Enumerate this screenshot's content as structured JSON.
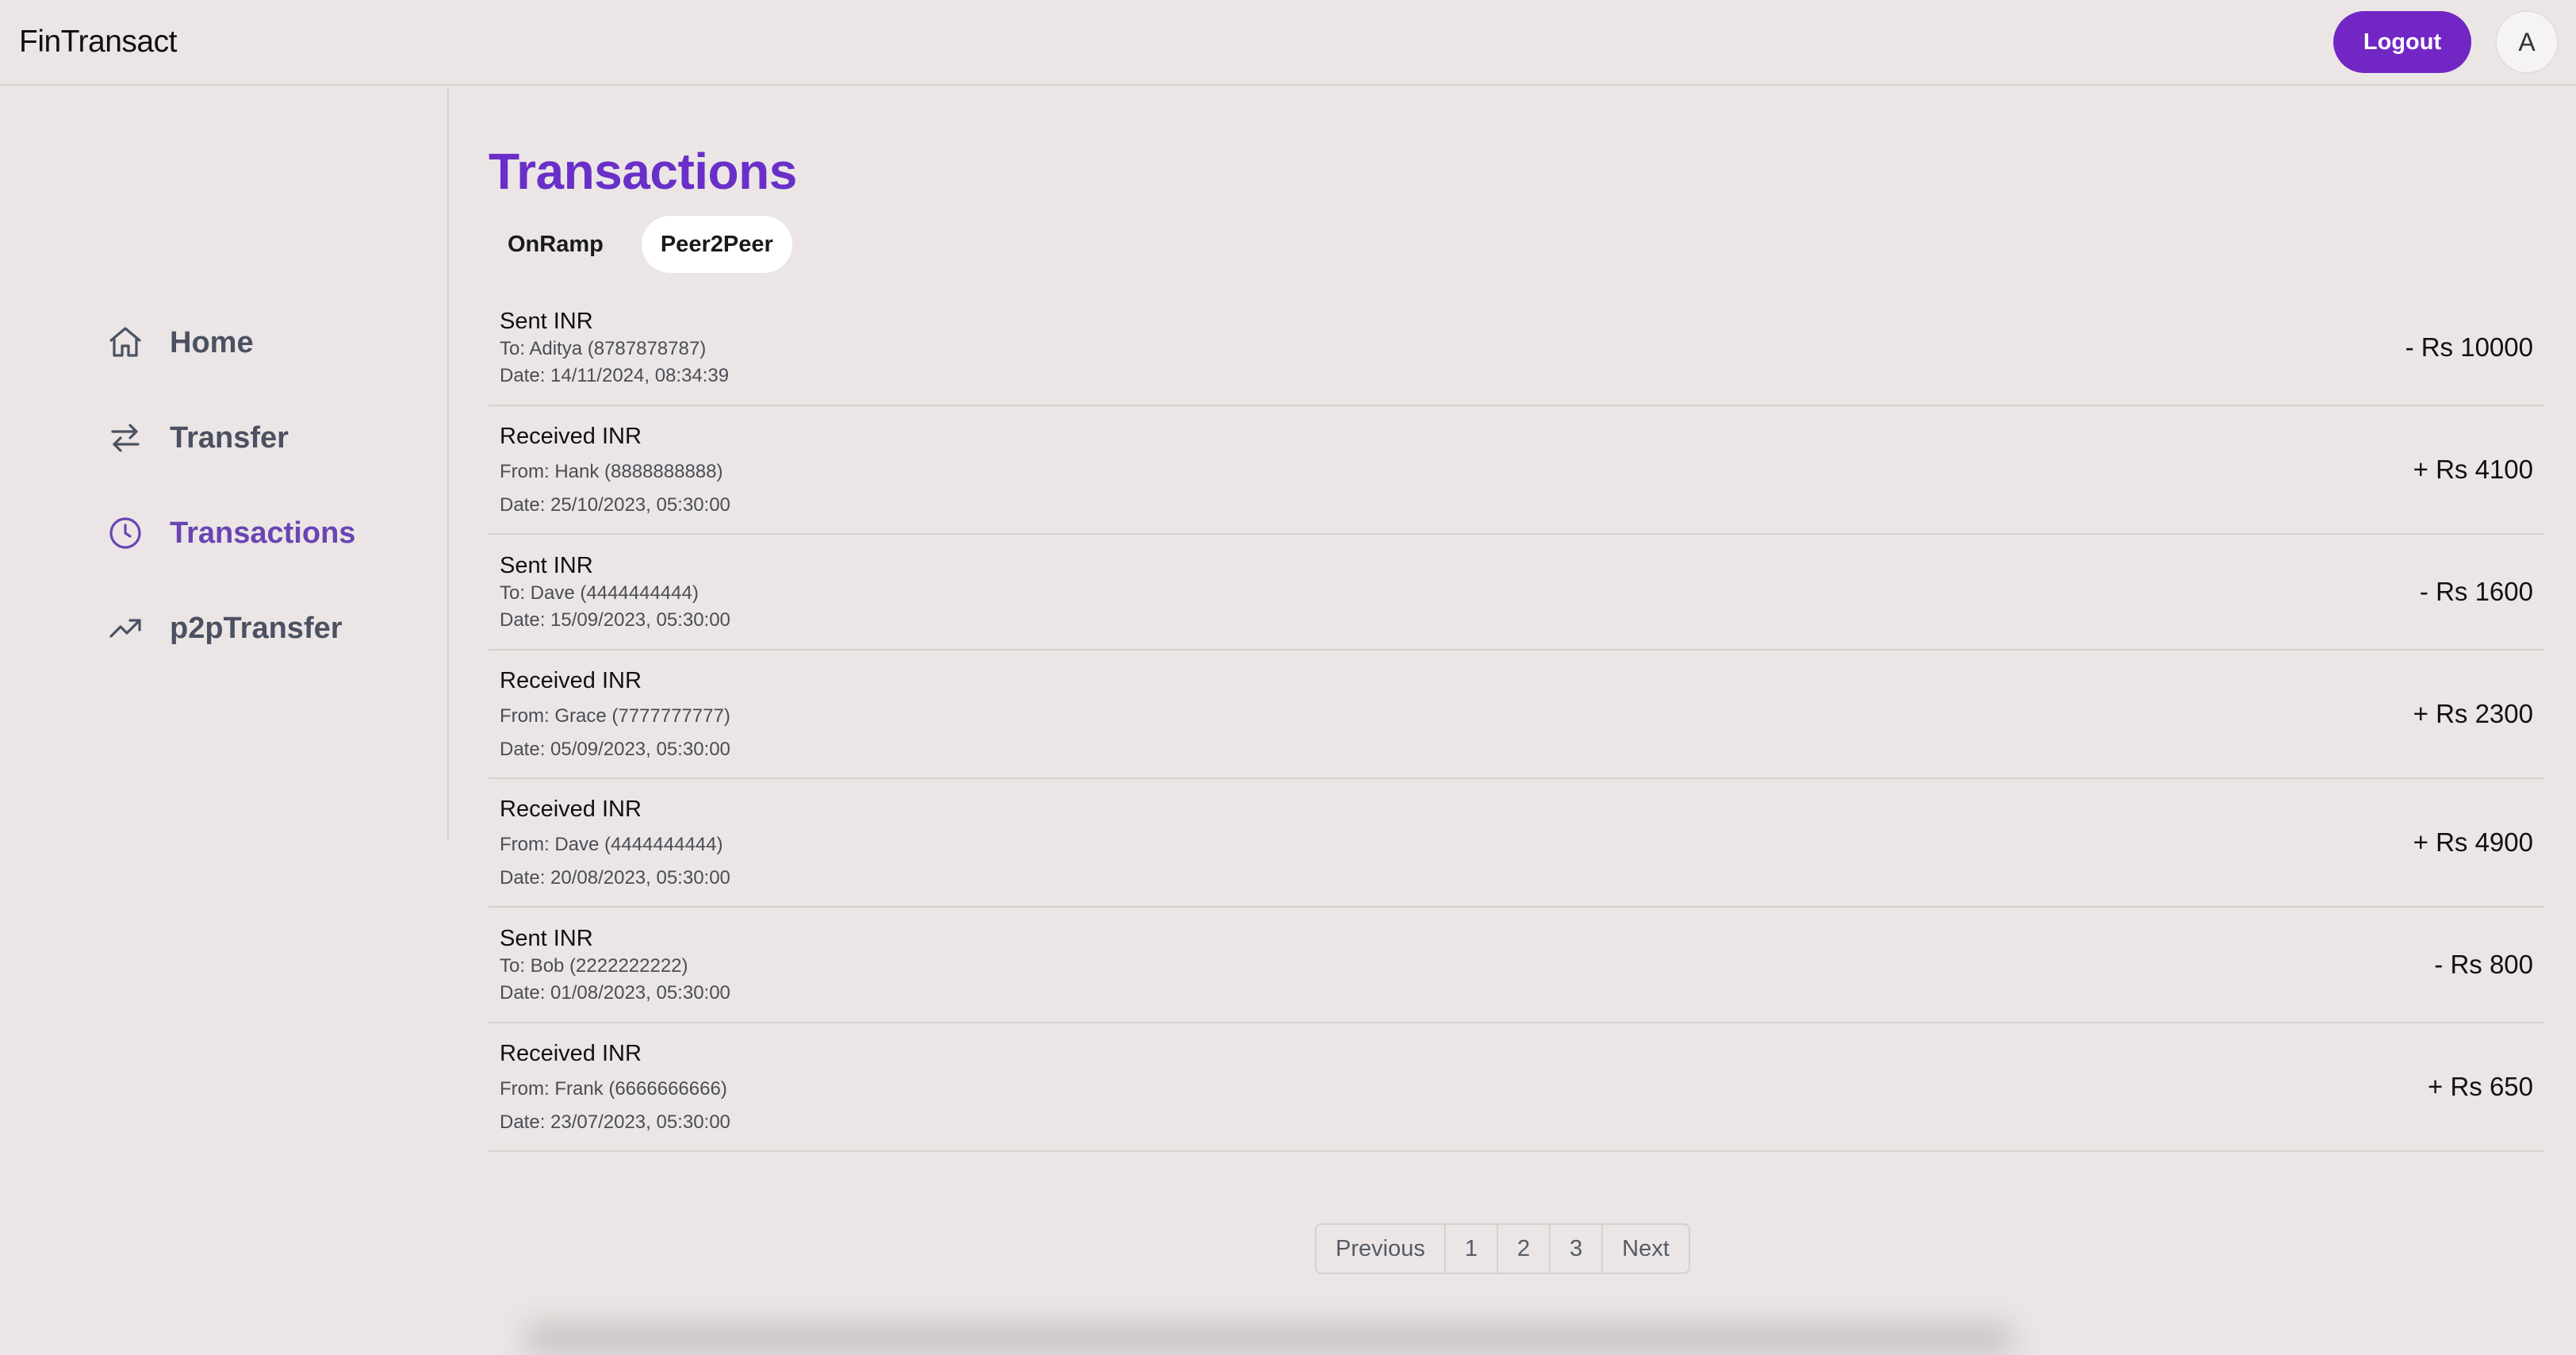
{
  "header": {
    "brand": "FinTransact",
    "logout_label": "Logout",
    "avatar_initial": "A"
  },
  "sidebar": {
    "items": [
      {
        "label": "Home",
        "icon": "home-icon"
      },
      {
        "label": "Transfer",
        "icon": "transfer-icon"
      },
      {
        "label": "Transactions",
        "icon": "clock-icon",
        "active": true
      },
      {
        "label": "p2pTransfer",
        "icon": "trend-icon"
      }
    ]
  },
  "main": {
    "title": "Transactions",
    "tabs": [
      {
        "label": "OnRamp",
        "active": false
      },
      {
        "label": "Peer2Peer",
        "active": true
      }
    ],
    "transactions": [
      {
        "type": "Sent INR",
        "party": "To: Aditya (8787878787)",
        "date": "Date: 14/11/2024, 08:34:39",
        "amount": "- Rs 10000"
      },
      {
        "type": "Received INR",
        "party": "From: Hank (8888888888)",
        "date": "Date: 25/10/2023, 05:30:00",
        "amount": "+ Rs 4100"
      },
      {
        "type": "Sent INR",
        "party": "To: Dave (4444444444)",
        "date": "Date: 15/09/2023, 05:30:00",
        "amount": "- Rs 1600"
      },
      {
        "type": "Received INR",
        "party": "From: Grace (7777777777)",
        "date": "Date: 05/09/2023, 05:30:00",
        "amount": "+ Rs 2300"
      },
      {
        "type": "Received INR",
        "party": "From: Dave (4444444444)",
        "date": "Date: 20/08/2023, 05:30:00",
        "amount": "+ Rs 4900"
      },
      {
        "type": "Sent INR",
        "party": "To: Bob (2222222222)",
        "date": "Date: 01/08/2023, 05:30:00",
        "amount": "- Rs 800"
      },
      {
        "type": "Received INR",
        "party": "From: Frank (6666666666)",
        "date": "Date: 23/07/2023, 05:30:00",
        "amount": "+ Rs 650"
      }
    ]
  },
  "pagination": {
    "previous": "Previous",
    "pages": [
      "1",
      "2",
      "3"
    ],
    "next": "Next"
  },
  "colors": {
    "accent": "#7226c4",
    "title": "#6a2fc9",
    "background": "#ebe6e5",
    "nav_active": "#6a44b4"
  }
}
